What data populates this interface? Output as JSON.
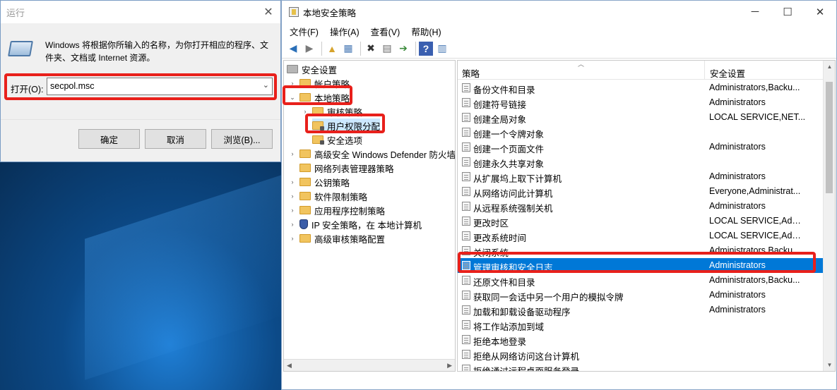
{
  "run_dialog": {
    "title": "运行",
    "description": "Windows 将根据你所输入的名称，为你打开相应的程序、文件夹、文档或 Internet 资源。",
    "open_label": "打开(O):",
    "input_value": "secpol.msc",
    "ok": "确定",
    "cancel": "取消",
    "browse": "浏览(B)..."
  },
  "secpol": {
    "title": "本地安全策略",
    "menu": [
      "文件(F)",
      "操作(A)",
      "查看(V)",
      "帮助(H)"
    ],
    "tree": [
      {
        "label": "安全设置",
        "level": 0,
        "arrow": "",
        "icon": "sec"
      },
      {
        "label": "帐户策略",
        "level": 1,
        "arrow": "›",
        "icon": "folder"
      },
      {
        "label": "本地策略",
        "level": 1,
        "arrow": "⌄",
        "icon": "folder"
      },
      {
        "label": "审核策略",
        "level": 2,
        "arrow": "›",
        "icon": "folder"
      },
      {
        "label": "用户权限分配",
        "level": 2,
        "arrow": "",
        "icon": "lock"
      },
      {
        "label": "安全选项",
        "level": 2,
        "arrow": "",
        "icon": "lock"
      },
      {
        "label": "高级安全 Windows Defender 防火墙",
        "level": 1,
        "arrow": "›",
        "icon": "folder"
      },
      {
        "label": "网络列表管理器策略",
        "level": 1,
        "arrow": "",
        "icon": "folder"
      },
      {
        "label": "公钥策略",
        "level": 1,
        "arrow": "›",
        "icon": "folder"
      },
      {
        "label": "软件限制策略",
        "level": 1,
        "arrow": "›",
        "icon": "folder"
      },
      {
        "label": "应用程序控制策略",
        "level": 1,
        "arrow": "›",
        "icon": "folder"
      },
      {
        "label": "IP 安全策略，在 本地计算机",
        "level": 1,
        "arrow": "›",
        "icon": "shield"
      },
      {
        "label": "高级审核策略配置",
        "level": 1,
        "arrow": "›",
        "icon": "folder"
      }
    ],
    "columns": {
      "policy": "策略",
      "setting": "安全设置"
    },
    "policies": [
      {
        "name": "备份文件和目录",
        "value": "Administrators,Backu..."
      },
      {
        "name": "创建符号链接",
        "value": "Administrators"
      },
      {
        "name": "创建全局对象",
        "value": "LOCAL SERVICE,NET..."
      },
      {
        "name": "创建一个令牌对象",
        "value": ""
      },
      {
        "name": "创建一个页面文件",
        "value": "Administrators"
      },
      {
        "name": "创建永久共享对象",
        "value": ""
      },
      {
        "name": "从扩展坞上取下计算机",
        "value": "Administrators"
      },
      {
        "name": "从网络访问此计算机",
        "value": "Everyone,Administrat..."
      },
      {
        "name": "从远程系统强制关机",
        "value": "Administrators"
      },
      {
        "name": "更改时区",
        "value": "LOCAL SERVICE,Admi..."
      },
      {
        "name": "更改系统时间",
        "value": "LOCAL SERVICE,Admi..."
      },
      {
        "name": "关闭系统",
        "value": "Administrators,Backu..."
      },
      {
        "name": "管理审核和安全日志",
        "value": "Administrators",
        "selected": true
      },
      {
        "name": "还原文件和目录",
        "value": "Administrators,Backu..."
      },
      {
        "name": "获取同一会话中另一个用户的模拟令牌",
        "value": "Administrators"
      },
      {
        "name": "加载和卸载设备驱动程序",
        "value": "Administrators"
      },
      {
        "name": "将工作站添加到域",
        "value": ""
      },
      {
        "name": "拒绝本地登录",
        "value": ""
      },
      {
        "name": "拒绝从网络访问这台计算机",
        "value": ""
      },
      {
        "name": "拒绝通过远程桌面服务登录",
        "value": ""
      }
    ]
  }
}
